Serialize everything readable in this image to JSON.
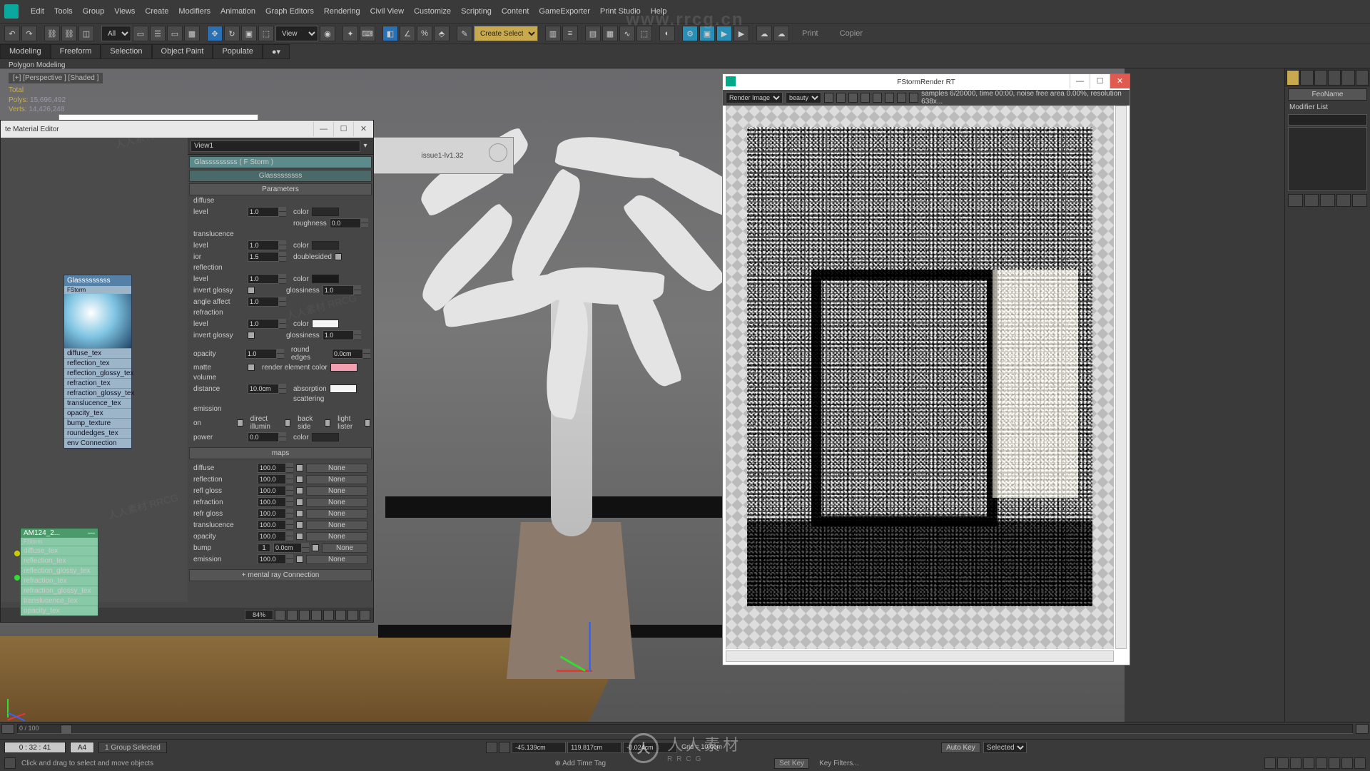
{
  "watermark_url": "www.rrcg.cn",
  "watermark_brand": "人人素材",
  "watermark_brand_sub": "RRCG",
  "menu": [
    "Edit",
    "Tools",
    "Group",
    "Views",
    "Create",
    "Modifiers",
    "Animation",
    "Graph Editors",
    "Rendering",
    "Civil View",
    "Customize",
    "Scripting",
    "Content",
    "GameExporter",
    "Print Studio",
    "Help"
  ],
  "toolbar": {
    "selection_set": "All",
    "create_set": "Create Selection Se",
    "print": "Print",
    "copier": "Copier"
  },
  "ribbon": {
    "tabs": [
      "Modeling",
      "Freeform",
      "Selection",
      "Object Paint",
      "Populate"
    ],
    "active": 0,
    "sub": "Polygon Modeling"
  },
  "viewport": {
    "label": "[+] [Perspective ] [Shaded ]",
    "stats": {
      "title": "Total",
      "polys": "15,696,492",
      "verts": "14,426,248"
    }
  },
  "tip_text": "issue1-lv1.32",
  "mat_editor": {
    "title": "te Material Editor",
    "view_dd": "View1",
    "mat_name": "Glasssssssss ( F Storm )",
    "rollname": "Glasssssssss",
    "params_header": "Parameters",
    "maps_header": "maps",
    "mental_ray": "mental ray Connection",
    "zoom": "84%",
    "node": {
      "name": "Glasssssssss",
      "sub": "FStorm",
      "slots": [
        "diffuse_tex",
        "reflection_tex",
        "reflection_glossy_tex",
        "refraction_tex",
        "refraction_glossy_tex",
        "translucence_tex",
        "opacity_tex",
        "bump_texture",
        "roundedges_tex",
        "env Connection"
      ]
    },
    "node_sm": {
      "name": "AM124_2...",
      "sub": "FStorm",
      "slots": [
        "diffuse_tex",
        "reflection_tex",
        "reflection_glossy_tex",
        "refraction_tex",
        "refraction_glossy_tex",
        "translucence_tex",
        "opacity_tex"
      ]
    },
    "diffuse": {
      "label": "diffuse",
      "level": "1.0",
      "color_lbl": "color",
      "color": "#2a2a2a",
      "roughness_lbl": "roughness",
      "roughness": "0.0"
    },
    "translucence": {
      "label": "translucence",
      "level": "1.0",
      "color": "#2a2a2a"
    },
    "ior": {
      "label": "ior",
      "val": "1.5",
      "double_sided": "doublesided"
    },
    "reflection": {
      "label": "reflection",
      "level": "1.0",
      "color": "#1a1a1a",
      "invert_glossy": "invert glossy",
      "glossiness_lbl": "glossiness",
      "glossiness": "1.0",
      "angle_affect": "angle affect",
      "angle_val": "1.0"
    },
    "refraction": {
      "label": "refraction",
      "level": "1.0",
      "color": "#f5f5f5",
      "invert_glossy": "invert glossy",
      "glossiness": "1.0"
    },
    "opacity": {
      "label": "opacity",
      "val": "1.0",
      "round_edges": "round edges",
      "round_val": "0.0cm"
    },
    "matte": {
      "label": "matte",
      "render_element": "render element color",
      "render_color": "#f29fb0"
    },
    "volume": {
      "label": "volume",
      "distance_lbl": "distance",
      "distance": "10.0cm",
      "absorption": "absorption",
      "abs_color": "#f5f5f5",
      "scattering": "scattering"
    },
    "emission": {
      "label": "emission",
      "on": "on",
      "direct_illumin": "direct illumin",
      "back_side": "back side",
      "light_lister": "light lister",
      "power": "power",
      "power_val": "0.0",
      "color_lbl": "color",
      "color": "#2a2a2a"
    },
    "maps": [
      {
        "name": "diffuse",
        "amt": "100.0",
        "on": true,
        "slot": "None"
      },
      {
        "name": "reflection",
        "amt": "100.0",
        "on": true,
        "slot": "None"
      },
      {
        "name": "refl gloss",
        "amt": "100.0",
        "on": true,
        "slot": "None"
      },
      {
        "name": "refraction",
        "amt": "100.0",
        "on": true,
        "slot": "None"
      },
      {
        "name": "refr gloss",
        "amt": "100.0",
        "on": true,
        "slot": "None"
      },
      {
        "name": "translucence",
        "amt": "100.0",
        "on": true,
        "slot": "None"
      },
      {
        "name": "opacity",
        "amt": "100.0",
        "on": true,
        "slot": "None"
      },
      {
        "name": "bump",
        "amt": "0.0cm",
        "on": true,
        "slot": "None",
        "extra": "1"
      },
      {
        "name": "emission",
        "amt": "100.0",
        "on": true,
        "slot": "None"
      }
    ]
  },
  "render": {
    "title": "FStormRender RT",
    "dd1": "Render Image",
    "dd2": "beauty",
    "status": "samples 6/20000, time 00:00, noise free area 0.00%, resolution 638x..."
  },
  "cmd": {
    "name": "FeoName",
    "modifier_list": "Modifier List"
  },
  "timeline": {
    "range": "0 / 100"
  },
  "status": {
    "timecode": "0 : 32 : 41",
    "timecode_alt": "A4",
    "selection": "1 Group Selected",
    "prompt": "Click and drag to select and move objects",
    "x": "-45.139cm",
    "y": "119.817cm",
    "z": "-0.024cm",
    "grid": "Grid = 10.0cm",
    "add_time_tag": "Add Time Tag",
    "auto_key": "Auto Key",
    "selected": "Selected",
    "set_key": "Set Key",
    "key_filters": "Key Filters..."
  }
}
